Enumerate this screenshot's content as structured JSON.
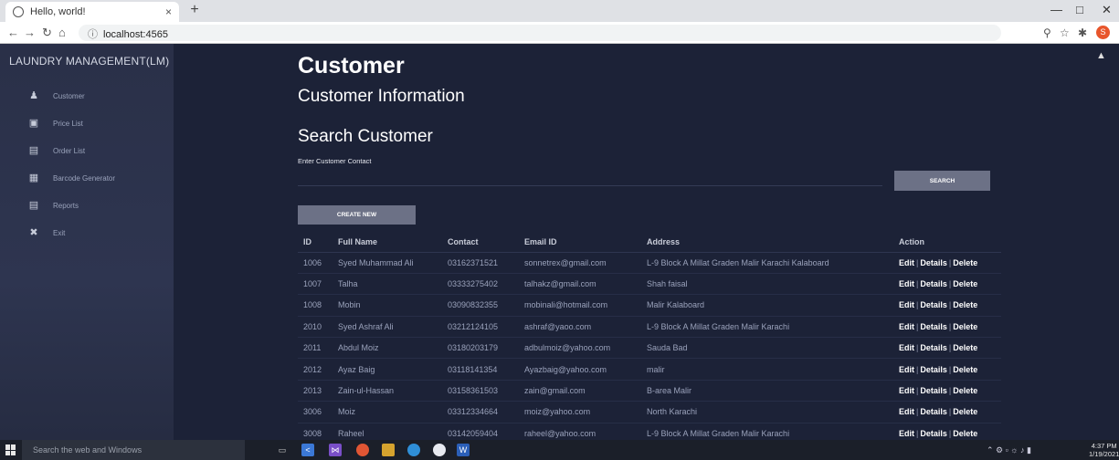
{
  "browser": {
    "tab_title": "Hello, world!",
    "tab_close": "×",
    "new_tab": "+",
    "url": "localhost:4565",
    "info_icon": "ⓘ",
    "window_controls": [
      "—",
      "□",
      "✕"
    ]
  },
  "sidebar": {
    "brand": "LAUNDRY MANAGEMENT(LM)",
    "items": [
      {
        "label": "Customer",
        "icon": "person-icon"
      },
      {
        "label": "Price List",
        "icon": "bag-icon"
      },
      {
        "label": "Order List",
        "icon": "list-icon"
      },
      {
        "label": "Barcode Generator",
        "icon": "qrcode-icon"
      },
      {
        "label": "Reports",
        "icon": "report-icon"
      },
      {
        "label": "Exit",
        "icon": "exit-icon"
      }
    ]
  },
  "main": {
    "title": "Customer",
    "subtitle": "Customer Information",
    "search_heading": "Search Customer",
    "search_label": "Enter Customer Contact",
    "search_value": "",
    "search_button": "SEARCH",
    "create_button": "CREATE NEW"
  },
  "table": {
    "headers": [
      "ID",
      "Full Name",
      "Contact",
      "Email ID",
      "Address",
      "Action"
    ],
    "actions": {
      "edit": "Edit",
      "details": "Details",
      "delete": "Delete",
      "sep": "|"
    },
    "rows": [
      {
        "id": "1006",
        "name": "Syed Muhammad Ali",
        "contact": "03162371521",
        "email": "sonnetrex@gmail.com",
        "address": "L-9 Block A Millat Graden Malir Karachi Kalaboard"
      },
      {
        "id": "1007",
        "name": "Talha",
        "contact": "03333275402",
        "email": "talhakz@gmail.com",
        "address": "Shah faisal"
      },
      {
        "id": "1008",
        "name": "Mobin",
        "contact": "03090832355",
        "email": "mobinali@hotmail.com",
        "address": "Malir Kalaboard"
      },
      {
        "id": "2010",
        "name": "Syed Ashraf Ali",
        "contact": "03212124105",
        "email": "ashraf@yaoo.com",
        "address": "L-9 Block A Millat Graden Malir Karachi"
      },
      {
        "id": "2011",
        "name": "Abdul Moiz",
        "contact": "03180203179",
        "email": "adbulmoiz@yahoo.com",
        "address": "Sauda Bad"
      },
      {
        "id": "2012",
        "name": "Ayaz Baig",
        "contact": "03118141354",
        "email": "Ayazbaig@yahoo.com",
        "address": "malir"
      },
      {
        "id": "2013",
        "name": "Zain-ul-Hassan",
        "contact": "03158361503",
        "email": "zain@gmail.com",
        "address": "B-area Malir"
      },
      {
        "id": "3006",
        "name": "Moiz",
        "contact": "03312334664",
        "email": "moiz@yahoo.com",
        "address": "North Karachi"
      },
      {
        "id": "3008",
        "name": "Raheel",
        "contact": "03142059404",
        "email": "raheel@yahoo.com",
        "address": "L-9 Block A Millat Graden Malir Karachi"
      }
    ]
  },
  "taskbar": {
    "search_placeholder": "Search the web and Windows",
    "time": "4:37 PM",
    "date": "1/19/2021"
  }
}
